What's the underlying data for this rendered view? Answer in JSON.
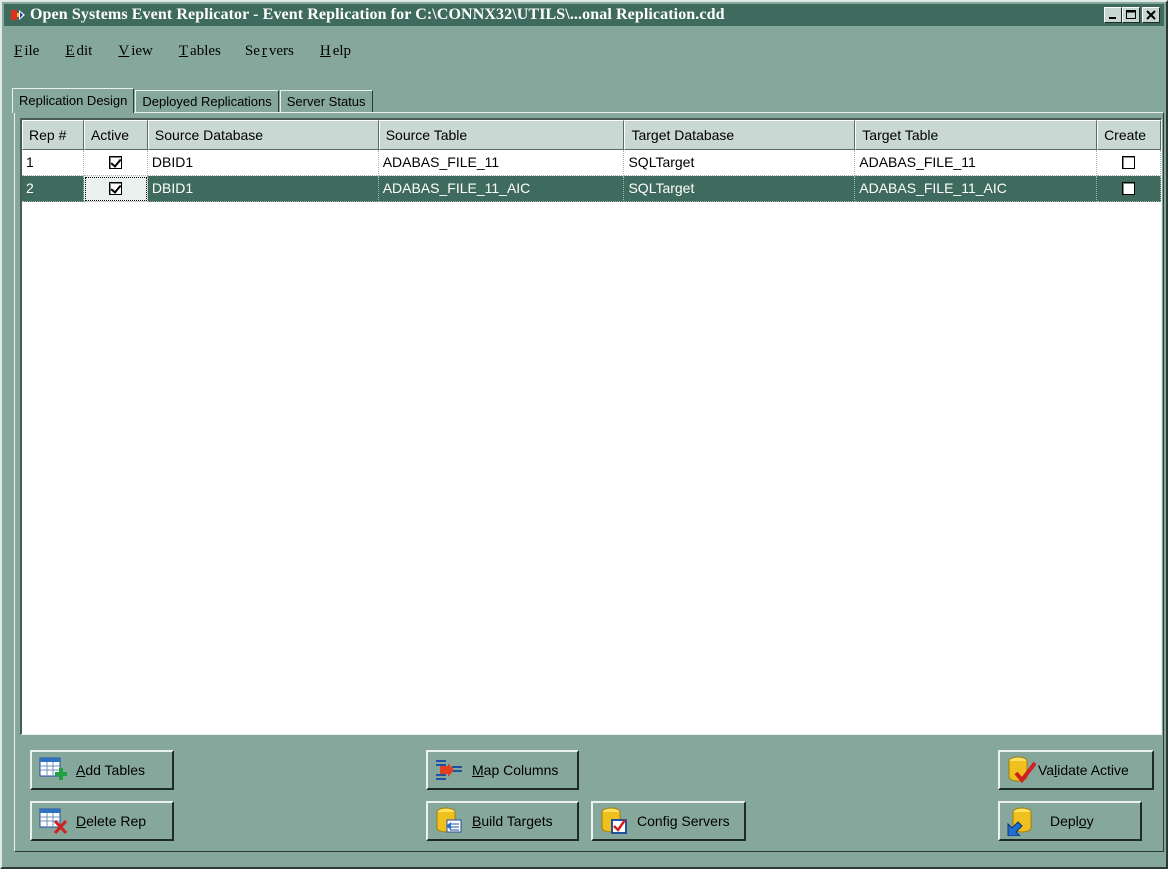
{
  "window": {
    "title": "Open Systems Event Replicator - Event Replication for C:\\CONNX32\\UTILS\\...onal Replication.cdd",
    "controls": [
      "minimize",
      "maximize",
      "close"
    ]
  },
  "menu": [
    {
      "label": "File",
      "mnemonic_index": 0
    },
    {
      "label": "Edit",
      "mnemonic_index": 0
    },
    {
      "label": "View",
      "mnemonic_index": 0
    },
    {
      "label": "Tables",
      "mnemonic_index": 0
    },
    {
      "label": "Servers",
      "mnemonic_index": 2
    },
    {
      "label": "Help",
      "mnemonic_index": 0
    }
  ],
  "tabs": [
    {
      "label": "Replication Design",
      "active": true
    },
    {
      "label": "Deployed Replications",
      "active": false
    },
    {
      "label": "Server Status",
      "active": false
    }
  ],
  "grid": {
    "columns": [
      "Rep #",
      "Active",
      "Source Database",
      "Source Table",
      "Target Database",
      "Target Table",
      "Create"
    ],
    "rows": [
      {
        "rep": "1",
        "active": true,
        "source_db": "DBID1",
        "source_table": "ADABAS_FILE_11",
        "target_db": "SQLTarget",
        "target_table": "ADABAS_FILE_11",
        "create": false,
        "selected": false
      },
      {
        "rep": "2",
        "active": true,
        "source_db": "DBID1",
        "source_table": "ADABAS_FILE_11_AIC",
        "target_db": "SQLTarget",
        "target_table": "ADABAS_FILE_11_AIC",
        "create": false,
        "selected": true
      }
    ]
  },
  "buttons": {
    "add_tables": {
      "pre": "",
      "mn": "A",
      "post": "dd Tables",
      "icon": "add-table-icon"
    },
    "delete_rep": {
      "pre": "",
      "mn": "D",
      "post": "elete Rep",
      "icon": "delete-table-icon"
    },
    "map_columns": {
      "pre": "",
      "mn": "M",
      "post": "ap Columns",
      "icon": "map-columns-icon"
    },
    "build_targets": {
      "pre": "",
      "mn": "B",
      "post": "uild Targets",
      "icon": "database-build-icon"
    },
    "config_servers": {
      "pre": "Confi",
      "mn": "g",
      "post": " Servers",
      "icon": "database-config-icon"
    },
    "validate_active": {
      "pre": "Va",
      "mn": "l",
      "post": "idate Active",
      "icon": "database-validate-icon"
    },
    "deploy": {
      "pre": "Depl",
      "mn": "o",
      "post": "y",
      "icon": "database-deploy-icon"
    }
  },
  "colors": {
    "window_bg": "#86a79c",
    "titlebar": "#3f6b5e",
    "selection": "#3f6b5e"
  }
}
